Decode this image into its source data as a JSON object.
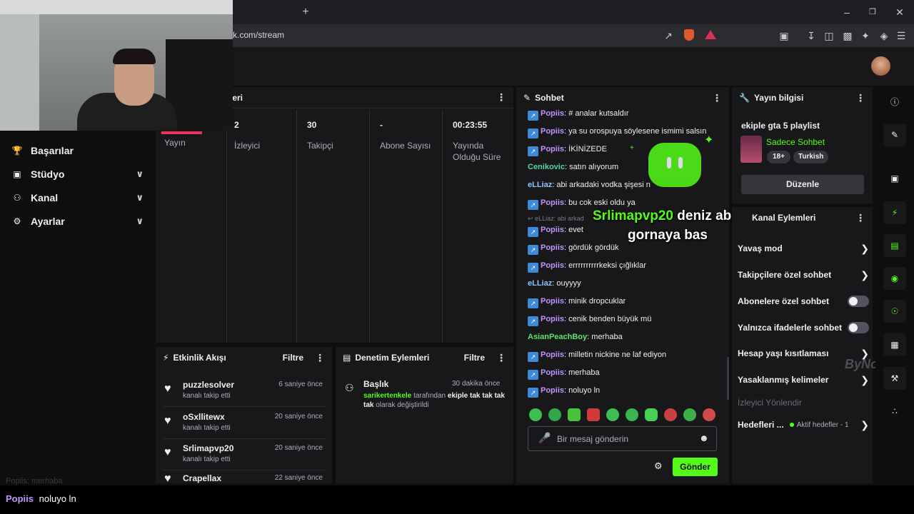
{
  "browser": {
    "url": "k.com/stream",
    "new_tab": "+"
  },
  "nav": {
    "items": [
      {
        "label": "Başarılar",
        "icon": "trophy-icon"
      },
      {
        "label": "Stüdyo",
        "icon": "studio-icon"
      },
      {
        "label": "Kanal",
        "icon": "users-icon"
      },
      {
        "label": "Ayarlar",
        "icon": "gear-icon"
      }
    ]
  },
  "stats_panel": {
    "title_partial": "leri",
    "stats": [
      {
        "value": "",
        "label": "Yayın"
      },
      {
        "value": "2",
        "label": "İzleyici"
      },
      {
        "value": "30",
        "label": "Takipçi"
      },
      {
        "value": "-",
        "label": "Abone Sayısı"
      },
      {
        "value": "00:23:55",
        "label": "Yayında Olduğu Süre"
      }
    ]
  },
  "events": {
    "title": "Etkinlik Akışı",
    "filter": "Filtre",
    "items": [
      {
        "name": "puzzlesolver",
        "action": "kanalı takip etti",
        "time": "6 saniye önce"
      },
      {
        "name": "oSxllitewx",
        "action": "kanalı takip etti",
        "time": "20 saniye önce"
      },
      {
        "name": "Srlimapvp20",
        "action": "kanalı takip etti",
        "time": "20 saniye önce"
      },
      {
        "name": "Crapellax",
        "action": "",
        "time": "22 saniye önce"
      }
    ]
  },
  "moderation": {
    "title": "Denetim Eylemleri",
    "filter": "Filtre",
    "entry": {
      "title": "Başlık",
      "time": "30 dakika önce",
      "user": "sarikertenkele",
      "middle": "tarafından",
      "new_title": "ekiple tak tak tak tak",
      "suffix": "olarak değiştirildi"
    }
  },
  "chat": {
    "title": "Sohbet",
    "messages": [
      {
        "user": "Popiis",
        "text": "# analar kutsaldır",
        "color": "purple",
        "badge": true
      },
      {
        "user": "Popiis",
        "text": "ya su orospuya söylesene ismimi salsın",
        "color": "purple",
        "badge": true
      },
      {
        "user": "Popiis",
        "text": "İKİNİZEDE",
        "color": "purple",
        "badge": true
      },
      {
        "user": "Cenikovic",
        "text": "satın alıyorum",
        "color": "green",
        "badge": false
      },
      {
        "user": "eLLiaz",
        "text": "abi arkadaki vodka şişesi n",
        "color": "blue",
        "badge": false
      },
      {
        "user": "Popiis",
        "text": "bu cok eski oldu ya",
        "color": "purple",
        "badge": true
      },
      {
        "user": "Popiis",
        "text": "evet",
        "color": "purple",
        "badge": true
      },
      {
        "user": "Popiis",
        "text": "gördük gördük",
        "color": "purple",
        "badge": true
      },
      {
        "user": "Popiis",
        "text": "errrrrrrrrrkeksi çığlıklar",
        "color": "purple",
        "badge": true
      },
      {
        "user": "eLLiaz",
        "text": "ouyyyy",
        "color": "blue",
        "badge": false
      },
      {
        "user": "Popiis",
        "text": "minik dropcuklar",
        "color": "purple",
        "badge": true
      },
      {
        "user": "Popiis",
        "text": "cenik benden büyük mü",
        "color": "purple",
        "badge": true
      },
      {
        "user": "AsianPeachBoy",
        "text": "merhaba",
        "color": "green2",
        "badge": false
      },
      {
        "user": "Popiis",
        "text": "milletin nickine ne laf ediyon",
        "color": "purple",
        "badge": true
      },
      {
        "user": "Popiis",
        "text": "merhaba",
        "color": "purple",
        "badge": true
      },
      {
        "user": "Popiis",
        "text": "noluyo ln",
        "color": "purple",
        "badge": true
      }
    ],
    "reply_hint": "eLLiaz: abi arkad",
    "input_placeholder": "Bir mesaj gönderin",
    "send": "Gönder"
  },
  "overlay": {
    "follower_name": "Srlimapvp20",
    "line1_rest": " deniz abi",
    "line2": "gornaya bas"
  },
  "stream_info": {
    "title": "Yayın bilgisi",
    "stream_title": "ekiple gta 5 playlist",
    "category": "Sadece Sohbet",
    "tags": [
      "18+",
      "Turkish"
    ],
    "edit": "Düzenle"
  },
  "channel_actions": {
    "title": "Kanal Eylemleri",
    "rows": [
      {
        "label": "Yavaş mod",
        "control": "chevron"
      },
      {
        "label": "Takipçilere özel sohbet",
        "control": "chevron"
      },
      {
        "label": "Abonelere özel sohbet",
        "control": "toggle"
      },
      {
        "label": "Yalnızca ifadelerle sohbet",
        "control": "toggle"
      },
      {
        "label": "Hesap yaşı kısıtlaması",
        "control": "chevron"
      },
      {
        "label": "Yasaklanmış kelimeler",
        "control": "chevron"
      }
    ],
    "section": "İzleyici Yönlendir",
    "goals_label": "Hedefleri ...",
    "goals_status": "Aktif hedefler - 1"
  },
  "bottom_ticker": {
    "user": "Popiis",
    "text": "noluyo ln",
    "faded": "Popiis: merhaba"
  },
  "watermark": "ByNoGame",
  "colors": {
    "accent": "#53fc18",
    "bg": "#0e0e10",
    "panel": "#18181b"
  }
}
